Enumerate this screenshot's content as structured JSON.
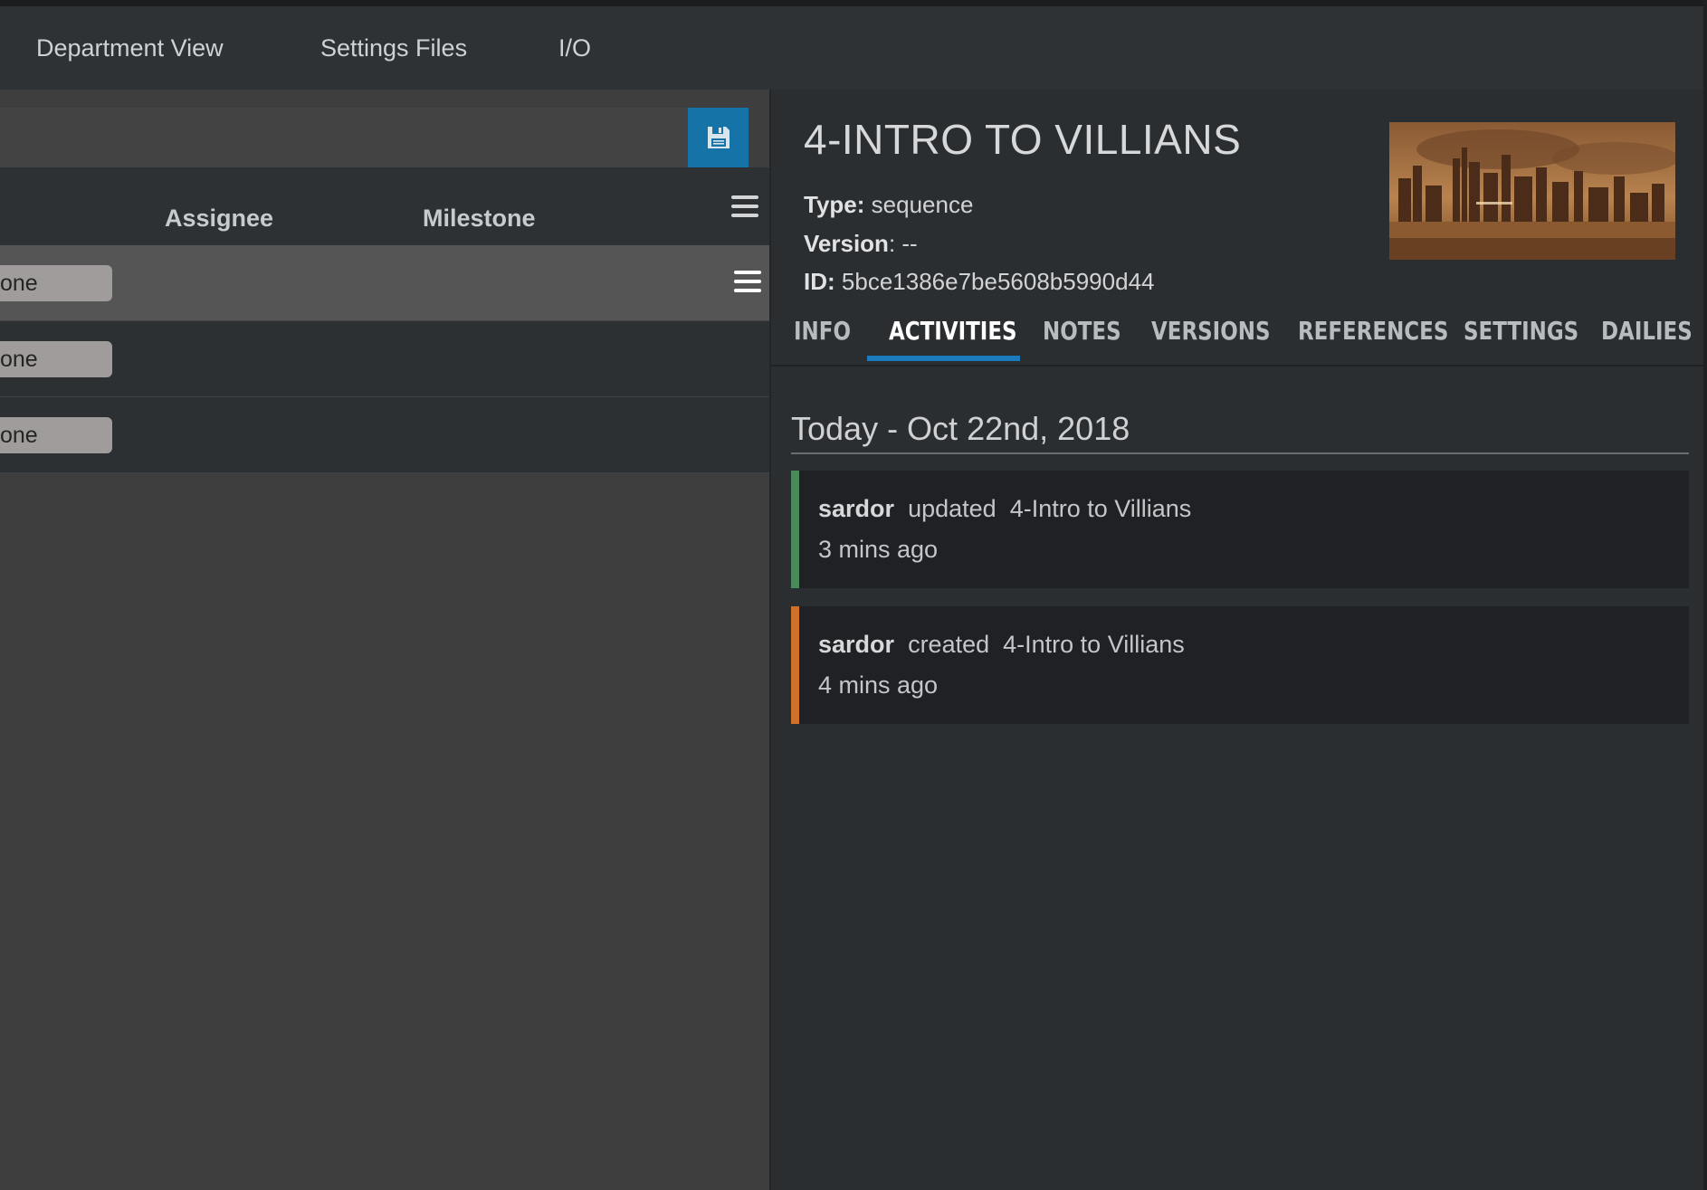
{
  "nav": {
    "items": [
      {
        "label": "Department View"
      },
      {
        "label": "Settings Files"
      },
      {
        "label": "I/O"
      }
    ]
  },
  "left_pane": {
    "save_icon": "floppy-disk-icon",
    "columns": {
      "assignee": "Assignee",
      "milestone": "Milestone"
    },
    "column_menu_icon": "hamburger-menu-icon",
    "rows": [
      {
        "status": "one",
        "selected": true
      },
      {
        "status": "one",
        "selected": false
      },
      {
        "status": "one",
        "selected": false
      }
    ]
  },
  "detail": {
    "title": "4-INTRO TO VILLIANS",
    "type_label": "Type:",
    "type_value": "sequence",
    "version_label": "Version",
    "version_value": ": --",
    "id_label": "ID:",
    "id_value": "5bce1386e7be5608b5990d44",
    "tabs": [
      "INFO",
      "ACTIVITIES",
      "NOTES",
      "VERSIONS",
      "REFERENCES",
      "SETTINGS",
      "DAILIES"
    ],
    "active_tab": "ACTIVITIES",
    "activity_date": "Today - Oct 22nd, 2018",
    "activities": [
      {
        "user": "sardor",
        "action": "updated",
        "target": "4-Intro to Villians",
        "time": "3 mins ago",
        "color": "#4a8a5a"
      },
      {
        "user": "sardor",
        "action": "created",
        "target": "4-Intro to Villians",
        "time": "4 mins ago",
        "color": "#d0712a"
      }
    ]
  },
  "colors": {
    "accent": "#1573a8",
    "tab_underline": "#1a7bbd",
    "updated_bar": "#4a8a5a",
    "created_bar": "#d0712a"
  }
}
